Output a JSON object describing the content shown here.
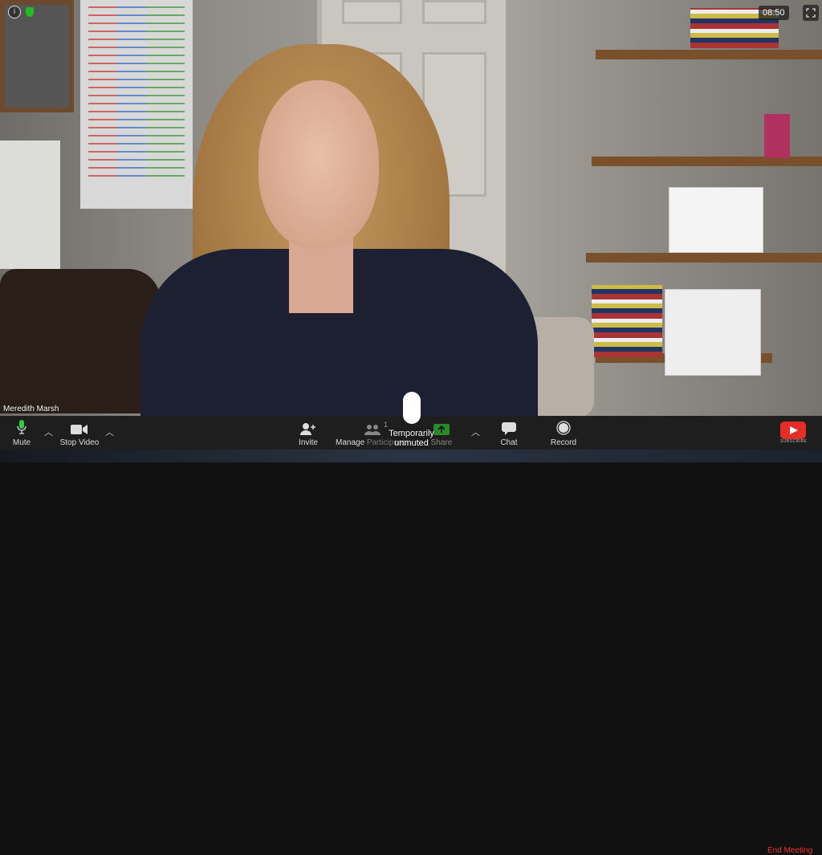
{
  "meeting": {
    "timer": "08:50",
    "participant_name": "Meredith Marsh",
    "participant_count": "1"
  },
  "toolbar": {
    "mute": "Mute",
    "stop_video": "Stop Video",
    "invite": "Invite",
    "manage": "Manage",
    "participants": "Participants",
    "share": "Share",
    "chat": "Chat",
    "record": "Record",
    "end_meeting": "End Meeting"
  },
  "overlay": {
    "status": "Temporarily unmuted",
    "subscribe": "SUBSCRIBE"
  },
  "colors": {
    "toolbar": "#1e1e1e",
    "mic_active": "#2ecc40",
    "share": "#2a8a2a",
    "end_meeting": "#e33333",
    "youtube": "#e52d27"
  },
  "icons": {
    "info": "info-icon",
    "security": "shield-icon",
    "fullscreen": "fullscreen-icon"
  }
}
